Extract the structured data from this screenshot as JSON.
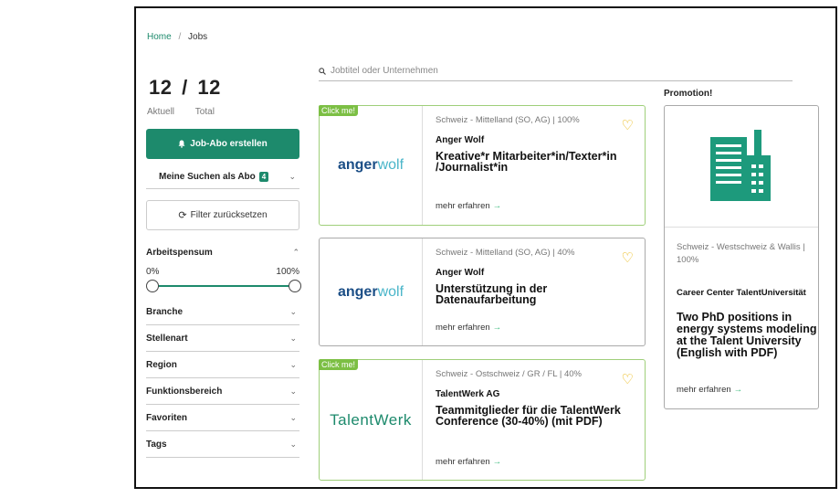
{
  "breadcrumb": {
    "home": "Home",
    "separator": "/",
    "current": "Jobs"
  },
  "counter": {
    "current": "12",
    "separator": "/",
    "total": "12",
    "current_label": "Aktuell",
    "total_label": "Total"
  },
  "sidebar": {
    "job_abo_button": "Job-Abo erstellen",
    "my_searches": {
      "label": "Meine Suchen als Abo",
      "badge": "4"
    },
    "reset_button": "Filter zurücksetzen",
    "pensum": {
      "label": "Arbeitspensum",
      "min_label": "0%",
      "max_label": "100%",
      "range_min": 0,
      "range_max": 100
    },
    "filters": [
      {
        "label": "Branche"
      },
      {
        "label": "Stellenart"
      },
      {
        "label": "Region"
      },
      {
        "label": "Funktionsbereich"
      },
      {
        "label": "Favoriten"
      },
      {
        "label": "Tags"
      }
    ]
  },
  "search": {
    "placeholder": "Jobtitel oder Unternehmen"
  },
  "jobs": [
    {
      "click_tag": "Click me!",
      "meta_location": "Schweiz - Mittelland (SO, AG)",
      "meta_pensum": "100%",
      "company": "Anger Wolf",
      "title": "Kreative*r Mitarbeiter*in/Texter*in /Journalist*in",
      "more": "mehr erfahren",
      "logo": {
        "part1": "anger",
        "part2": "wolf"
      }
    },
    {
      "click_tag": "",
      "meta_location": "Schweiz - Mittelland (SO, AG)",
      "meta_pensum": "40%",
      "company": "Anger Wolf",
      "title": "Unterstützung in der Datenaufarbeitung",
      "more": "mehr erfahren",
      "logo": {
        "part1": "anger",
        "part2": "wolf"
      }
    },
    {
      "click_tag": "Click me!",
      "meta_location": "Schweiz - Ostschweiz / GR / FL",
      "meta_pensum": "40%",
      "company": "TalentWerk AG",
      "title": "Teammitglieder für die TalentWerk Conference (30-40%) (mit PDF)",
      "more": "mehr erfahren",
      "logo": {
        "text": "TalentWerk"
      }
    }
  ],
  "promotion": {
    "label": "Promotion!",
    "meta_location": "Schweiz - Westschweiz & Wallis",
    "meta_pensum": "100%",
    "company": "Career Center TalentUniversität",
    "title": "Two PhD positions in energy systems modeling at the Talent University (English with PDF)",
    "more": "mehr erfahren"
  },
  "colors": {
    "accent": "#1d8a6c",
    "click_tag": "#7cbf44",
    "heart": "#e9b300",
    "card_highlight_border": "#9fcf7a"
  },
  "icons": [
    "bell-icon",
    "chevron-down-icon",
    "chevron-up-icon",
    "reset-icon",
    "search-icon",
    "heart-icon",
    "arrow-right-icon",
    "building-icon"
  ]
}
